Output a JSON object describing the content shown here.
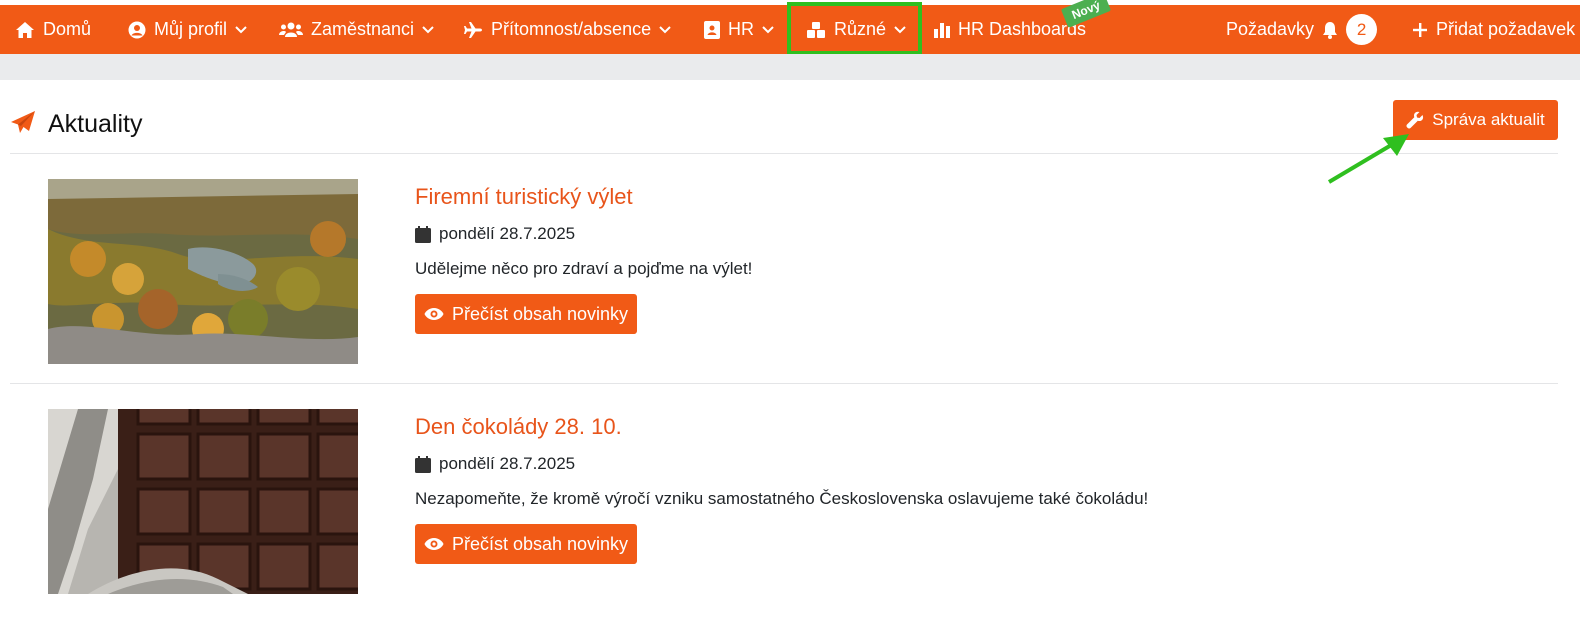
{
  "navbar": {
    "items": [
      {
        "label": "Domů",
        "icon": "home-icon"
      },
      {
        "label": "Můj profil",
        "icon": "user-circle-icon"
      },
      {
        "label": "Zaměstnanci",
        "icon": "users-icon"
      },
      {
        "label": "Přítomnost/absence",
        "icon": "plane-icon"
      },
      {
        "label": "HR",
        "icon": "address-book-icon"
      },
      {
        "label": "Různé",
        "icon": "cubes-icon"
      },
      {
        "label": "HR Dashboards",
        "icon": "bar-chart-icon"
      }
    ],
    "new_badge": "Nový",
    "requests_label": "Požadavky",
    "requests_count": "2",
    "add_request_label": "Přidat požadavek",
    "accent_color": "#f15a16",
    "highlight_color": "#2fbf1f"
  },
  "page": {
    "title": "Aktuality",
    "manage_label": "Správa aktualit"
  },
  "news": [
    {
      "title": "Firemní turistický výlet",
      "date": "pondělí 28.7.2025",
      "text": "Udělejme něco pro zdraví a pojďme na výlet!",
      "button": "Přečíst obsah novinky",
      "image": "autumn-valley-photo"
    },
    {
      "title": "Den čokolády 28. 10.",
      "date": "pondělí 28.7.2025",
      "text": "Nezapomeňte, že kromě výročí vzniku samostatného Československa oslavujeme také čokoládu!",
      "button": "Přečíst obsah novinky",
      "image": "chocolate-bar-photo"
    }
  ]
}
